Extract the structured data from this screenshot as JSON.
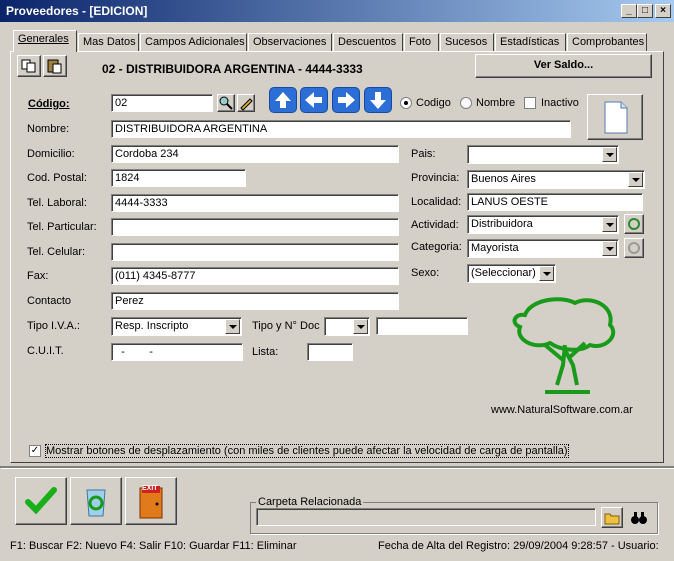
{
  "window": {
    "title": "Proveedores - [EDICION]",
    "min": "_",
    "max": "□",
    "close": "×"
  },
  "tabs": [
    {
      "label": "Generales"
    },
    {
      "label": "Mas Datos"
    },
    {
      "label": "Campos Adicionales"
    },
    {
      "label": "Observaciones"
    },
    {
      "label": "Descuentos"
    },
    {
      "label": "Foto"
    },
    {
      "label": "Sucesos"
    },
    {
      "label": "Estadísticas"
    },
    {
      "label": "Comprobantes"
    }
  ],
  "header": {
    "record_title": "02 - DISTRIBUIDORA ARGENTINA - 4444-3333",
    "ver_saldo": "Ver Saldo..."
  },
  "search": {
    "label": "Código:",
    "value": "02",
    "options": [
      "Codigo",
      "Nombre"
    ],
    "selected": "Codigo",
    "inactivo_label": "Inactivo",
    "inactivo_checked": false
  },
  "fields": {
    "nombre": {
      "label": "Nombre:",
      "value": "DISTRIBUIDORA ARGENTINA"
    },
    "domicilio": {
      "label": "Domicilio:",
      "value": "Cordoba 234"
    },
    "cod_postal": {
      "label": "Cod. Postal:",
      "value": "1824"
    },
    "tel_laboral": {
      "label": "Tel. Laboral:",
      "value": "4444-3333"
    },
    "tel_particular": {
      "label": "Tel. Particular:",
      "value": ""
    },
    "tel_celular": {
      "label": "Tel. Celular:",
      "value": ""
    },
    "fax": {
      "label": "Fax:",
      "value": "(011) 4345-8777"
    },
    "contacto": {
      "label": "Contacto",
      "value": "Perez"
    },
    "tipo_iva": {
      "label": "Tipo I.V.A.:",
      "value": "Resp. Inscripto"
    },
    "tipo_doc": {
      "label": "Tipo y N° Doc",
      "value": "",
      "number": ""
    },
    "cuit": {
      "label": "C.U.I.T.",
      "value": "  -        -"
    },
    "lista": {
      "label": "Lista:",
      "value": ""
    },
    "pais": {
      "label": "Pais:",
      "value": ""
    },
    "provincia": {
      "label": "Provincia:",
      "value": "Buenos Aires"
    },
    "localidad": {
      "label": "Localidad:",
      "value": "LANUS OESTE"
    },
    "actividad": {
      "label": "Actividad:",
      "value": "Distribuidora"
    },
    "categoria": {
      "label": "Categoria:",
      "value": "Mayorista"
    },
    "sexo": {
      "label": "Sexo:",
      "value": "(Seleccionar)"
    }
  },
  "logo": {
    "url_text": "www.NaturalSoftware.com.ar",
    "color": "#1a9a1a"
  },
  "options": {
    "mostrar_botones": "Mostrar botones de desplazamiento  (con miles de clientes puede afectar la velocidad de carga de pantalla)",
    "mostrar_checked": true
  },
  "carpeta": {
    "label": "Carpeta Relacionada",
    "value": ""
  },
  "exit_label": "EXIT",
  "status": {
    "shortcuts": "F1: Buscar  F2: Nuevo  F4: Salir  F10: Guardar  F11: Eliminar",
    "alta": "Fecha de Alta del Registro: 29/09/2004 9:28:57 - Usuario:"
  }
}
